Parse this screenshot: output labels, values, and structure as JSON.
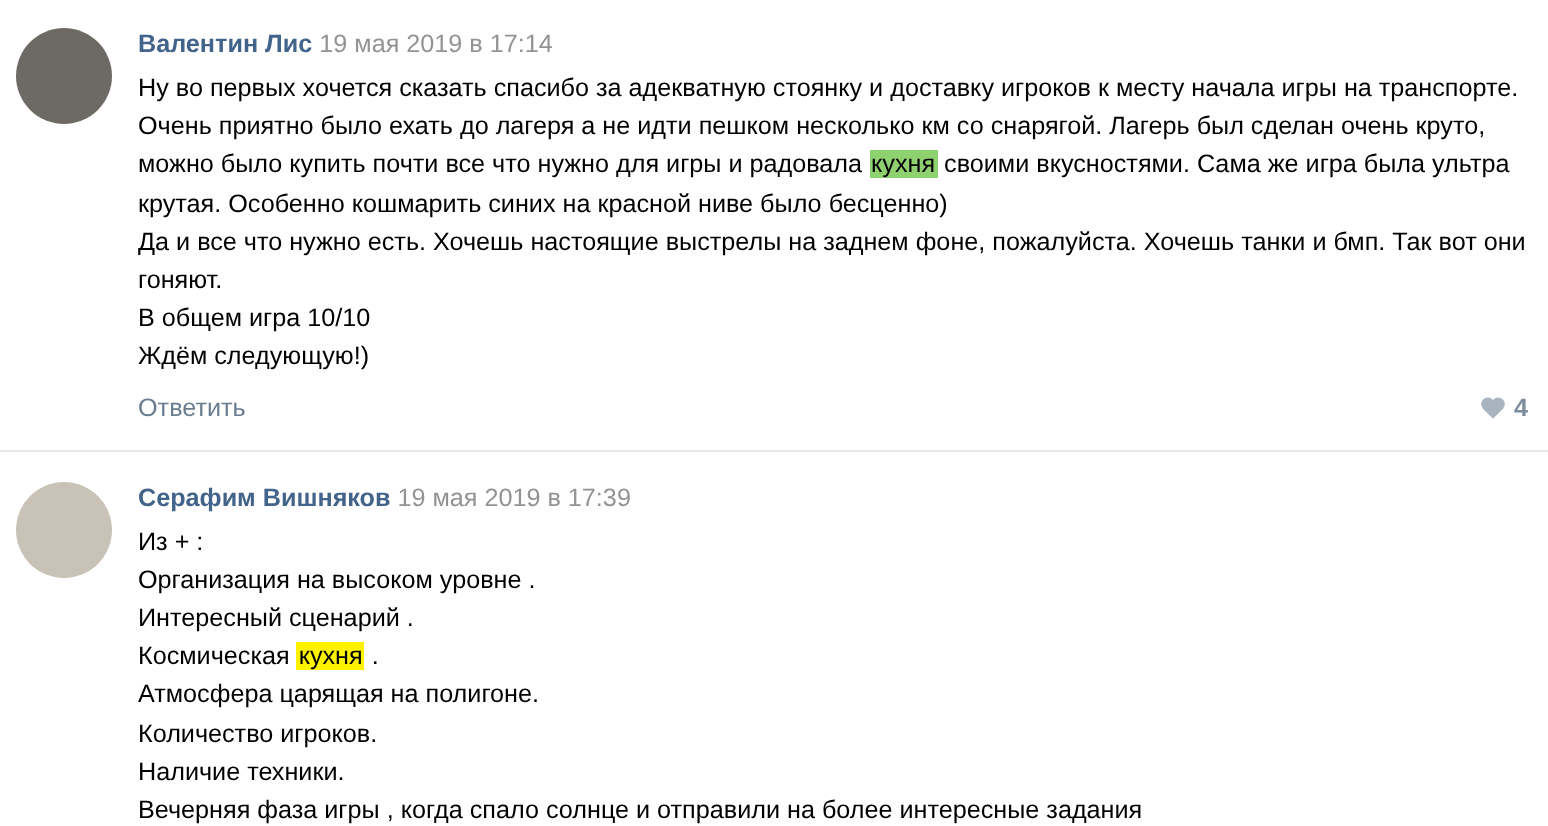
{
  "comments": [
    {
      "author": "Валентин Лис",
      "date": "19 мая 2019 в 17:14",
      "paragraphs": [
        [
          {
            "text": "Ну во первых хочется сказать спасибо за адекватную стоянку и доставку игроков к месту начала игры на транспорте. Очень приятно было ехать до лагеря а не идти пешком несколько км со снарягой. Лагерь был сделан очень круто, можно было купить почти все что нужно для игры и радовала "
          },
          {
            "text": "кухня",
            "color": "#8fd16f"
          },
          {
            "text": " своими вкусностями. Сама же игра была ультра крутая. Особенно кошмарить синих на красной ниве было бесценно)"
          }
        ],
        [
          {
            "text": "Да и все что нужно есть. Хочешь настоящие выстрелы на заднем фоне, пожалуйста. Хочешь танки и бмп. Так вот они гоняют."
          }
        ],
        [
          {
            "text": "В общем игра 10/10"
          }
        ],
        [
          {
            "text": "Ждём следующую!)"
          }
        ]
      ],
      "reply": "Ответить",
      "likes": "4"
    },
    {
      "author": "Серафим Вишняков",
      "date": "19 мая 2019 в 17:39",
      "paragraphs": [
        [
          {
            "text": "Из + :"
          }
        ],
        [
          {
            "text": "Организация на высоком уровне ."
          }
        ],
        [
          {
            "text": "Интересный сценарий ."
          }
        ],
        [
          {
            "text": "Космическая "
          },
          {
            "text": "кухня",
            "color": "#fff200"
          },
          {
            "text": " ."
          }
        ],
        [
          {
            "text": "Атмосфера царящая на полигоне."
          }
        ],
        [
          {
            "text": "Количество игроков."
          }
        ],
        [
          {
            "text": "Наличие техники."
          }
        ],
        [
          {
            "text": "Вечерняя фаза игры , когда спало солнце и отправили на более интересные задания"
          }
        ]
      ]
    }
  ]
}
